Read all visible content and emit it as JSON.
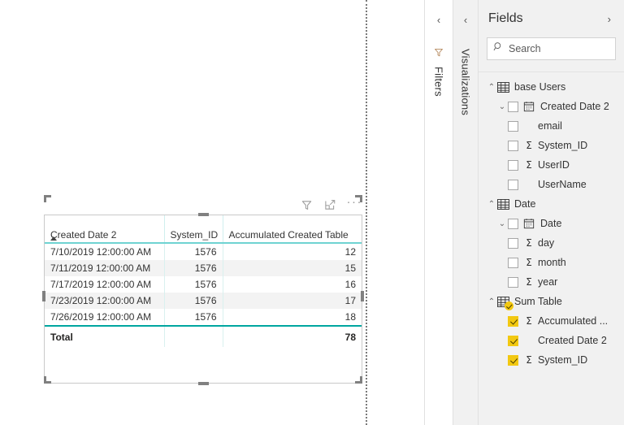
{
  "canvas": {
    "visual": {
      "toolbar": {
        "filter_icon": "filter-funnel-icon",
        "focus_icon": "focus-mode-icon",
        "more_label": "···"
      },
      "table": {
        "columns": [
          {
            "header": "Created Date 2",
            "align": "left",
            "sorted": "ascending"
          },
          {
            "header": "System_ID",
            "align": "right",
            "sorted": "none"
          },
          {
            "header": "Accumulated Created Table",
            "align": "right",
            "sorted": "none"
          }
        ],
        "rows": [
          {
            "date": "7/10/2019 12:00:00 AM",
            "system_id": "1576",
            "accumulated": "12"
          },
          {
            "date": "7/11/2019 12:00:00 AM",
            "system_id": "1576",
            "accumulated": "15"
          },
          {
            "date": "7/17/2019 12:00:00 AM",
            "system_id": "1576",
            "accumulated": "16"
          },
          {
            "date": "7/23/2019 12:00:00 AM",
            "system_id": "1576",
            "accumulated": "17"
          },
          {
            "date": "7/26/2019 12:00:00 AM",
            "system_id": "1576",
            "accumulated": "18"
          }
        ],
        "total": {
          "label": "Total",
          "system_id": "",
          "accumulated": "78"
        }
      }
    }
  },
  "panes": {
    "filters": {
      "label": "Filters",
      "collapse_chevron": "‹",
      "icon": "filter-funnel-icon"
    },
    "visualizations": {
      "label": "Visualizations",
      "collapse_chevron": "‹"
    },
    "fields": {
      "title": "Fields",
      "expand_chevron": "›",
      "search": {
        "placeholder": "Search",
        "value": "",
        "icon": "search-icon"
      },
      "tree": [
        {
          "name": "base Users",
          "type": "table",
          "expanded": true,
          "chevron": "⌃",
          "icon": "table-grid-icon",
          "checked": false,
          "children": [
            {
              "name": "Created Date 2",
              "level": "group",
              "chevron": "⌄",
              "checkbox": true,
              "checked": false,
              "icon": "calendar-icon",
              "aggregate": ""
            },
            {
              "name": "email",
              "level": "field",
              "checkbox": true,
              "checked": false,
              "aggregate": ""
            },
            {
              "name": "System_ID",
              "level": "field",
              "checkbox": true,
              "checked": false,
              "aggregate": "Σ"
            },
            {
              "name": "UserID",
              "level": "field",
              "checkbox": true,
              "checked": false,
              "aggregate": "Σ"
            },
            {
              "name": "UserName",
              "level": "field",
              "checkbox": true,
              "checked": false,
              "aggregate": ""
            }
          ]
        },
        {
          "name": "Date",
          "type": "table",
          "expanded": true,
          "chevron": "⌃",
          "icon": "table-grid-icon",
          "checked": false,
          "children": [
            {
              "name": "Date",
              "level": "group",
              "chevron": "⌄",
              "checkbox": true,
              "checked": false,
              "icon": "calendar-icon",
              "aggregate": ""
            },
            {
              "name": "day",
              "level": "field",
              "checkbox": true,
              "checked": false,
              "aggregate": "Σ"
            },
            {
              "name": "month",
              "level": "field",
              "checkbox": true,
              "checked": false,
              "aggregate": "Σ"
            },
            {
              "name": "year",
              "level": "field",
              "checkbox": true,
              "checked": false,
              "aggregate": "Σ"
            }
          ]
        },
        {
          "name": "Sum Table",
          "type": "table",
          "expanded": true,
          "chevron": "⌃",
          "icon": "table-grid-icon",
          "checked": true,
          "children": [
            {
              "name": "Accumulated ...",
              "level": "field",
              "checkbox": true,
              "checked": true,
              "aggregate": "Σ"
            },
            {
              "name": "Created Date 2",
              "level": "field",
              "checkbox": true,
              "checked": true,
              "aggregate": ""
            },
            {
              "name": "System_ID",
              "level": "field",
              "checkbox": true,
              "checked": true,
              "aggregate": "Σ"
            }
          ]
        }
      ]
    }
  },
  "colors": {
    "accent_yellow": "#f2c811",
    "table_teal": "#00a6a0",
    "table_teal_light": "#6fd3d2",
    "row_alt": "#f3f3f3",
    "pane_bg": "#f1f1f1",
    "text": "#333333",
    "selection_handle": "#808080"
  }
}
